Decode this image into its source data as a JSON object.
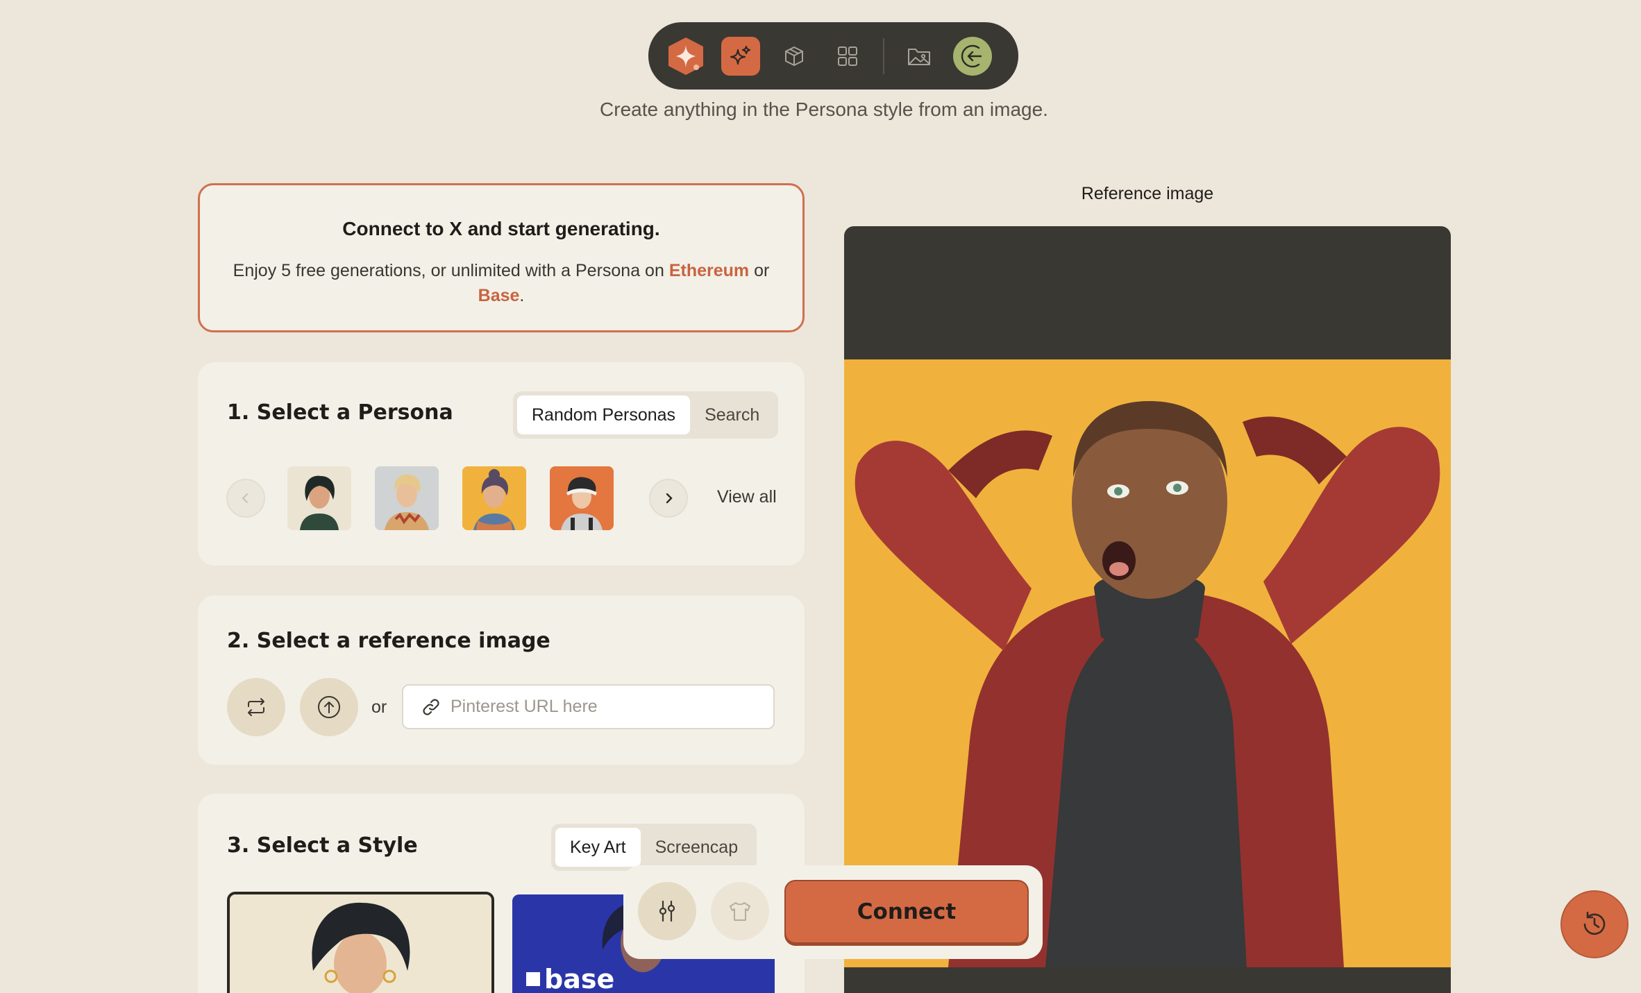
{
  "toolbar": {
    "items": [
      "persona-logo",
      "sparkles",
      "box",
      "grid",
      "gallery",
      "account"
    ]
  },
  "subtitle": "Create anything in the Persona style from an image.",
  "connect_card": {
    "title": "Connect to X and start generating.",
    "body_prefix": "Enjoy 5 free generations, or unlimited with a Persona on",
    "link_ethereum": "Ethereum",
    "or": "or",
    "link_base": "Base",
    "period": "."
  },
  "step1": {
    "title": "1. Select a Persona",
    "tabs": [
      "Random Personas",
      "Search"
    ],
    "active_tab": "Random Personas",
    "view_all": "View all"
  },
  "step2": {
    "title": "2. Select a reference image",
    "or": "or",
    "url_placeholder": "Pinterest URL here"
  },
  "step3": {
    "title": "3. Select a Style",
    "tabs": [
      "Key Art",
      "Screencap"
    ],
    "active_tab": "Key Art",
    "style2_label": "base"
  },
  "reference": {
    "label": "Reference image"
  },
  "action_bar": {
    "connect_label": "Connect"
  },
  "colors": {
    "accent": "#d46a44",
    "background": "#ede6da",
    "card": "#f3f0e8",
    "toolbar": "#3a3833"
  }
}
